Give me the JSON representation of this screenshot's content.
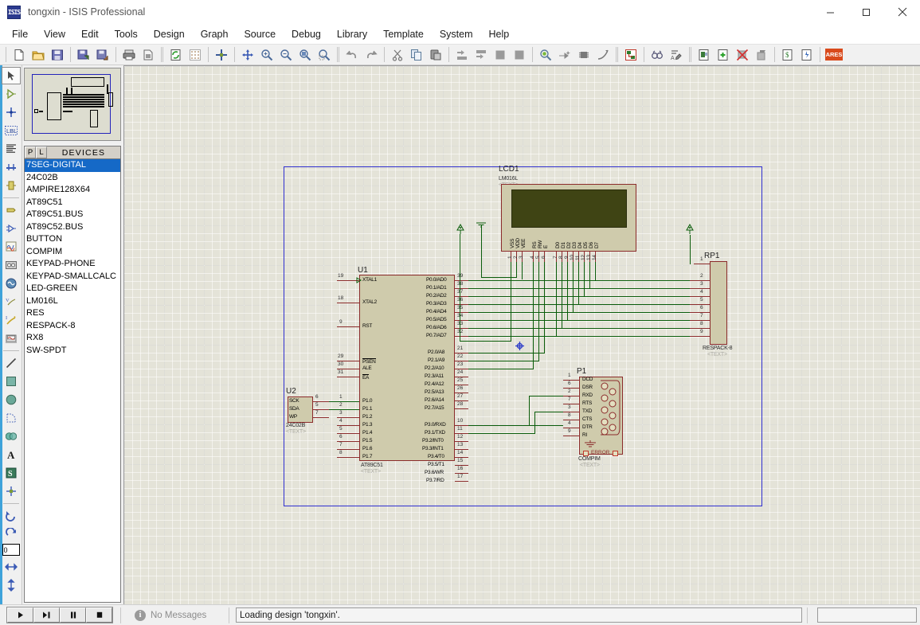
{
  "window": {
    "title": "tongxin - ISIS Professional",
    "app_icon": "isis-logo-icon",
    "minimize": "minimize-icon",
    "maximize": "maximize-icon",
    "close": "close-icon"
  },
  "menu": {
    "items": [
      {
        "label": "File"
      },
      {
        "label": "View"
      },
      {
        "label": "Edit"
      },
      {
        "label": "Tools"
      },
      {
        "label": "Design"
      },
      {
        "label": "Graph"
      },
      {
        "label": "Source"
      },
      {
        "label": "Debug"
      },
      {
        "label": "Library"
      },
      {
        "label": "Template"
      },
      {
        "label": "System"
      },
      {
        "label": "Help"
      }
    ]
  },
  "toolbar": {
    "groups": [
      [
        "new-file-icon",
        "open-folder-icon",
        "save-icon"
      ],
      [
        "import-section-icon",
        "export-section-icon"
      ],
      [
        "print-icon",
        "print-region-icon"
      ],
      [
        "refresh-display-icon",
        "toggle-grid-icon"
      ],
      [
        "origin-icon"
      ],
      [
        "pan-icon",
        "zoom-in-icon",
        "zoom-out-icon",
        "zoom-area-icon",
        "zoom-sheet-icon"
      ],
      [
        "undo-icon",
        "redo-icon"
      ],
      [
        "cut-icon",
        "copy-icon",
        "paste-icon"
      ],
      [
        "copy-block-icon",
        "move-block-icon",
        "rotate-block-icon",
        "delete-block-icon"
      ],
      [
        "pick-device-icon",
        "make-device-icon",
        "packaging-tool-icon",
        "decompose-icon"
      ],
      [
        "wire-label-icon"
      ],
      [
        "property-assignment-icon",
        "design-explorer-icon"
      ],
      [
        "new-sheet-icon",
        "remove-sheet-icon",
        "exit-sheet-icon",
        "bill-of-materials-icon"
      ],
      [
        "electrical-rules-check-icon",
        "netlist-icon"
      ],
      [
        "ares-pcb-icon"
      ]
    ],
    "ares_label": "ARES"
  },
  "vertical_toolbar": {
    "items": [
      {
        "name": "selection-mode-icon",
        "selected": true
      },
      {
        "name": "component-mode-icon",
        "selected": false
      },
      {
        "name": "junction-dot-mode-icon",
        "selected": false
      },
      {
        "name": "wire-label-mode-icon",
        "selected": false
      },
      {
        "name": "text-script-mode-icon",
        "selected": false
      },
      {
        "name": "buses-mode-icon",
        "selected": false
      },
      {
        "name": "subcircuit-mode-icon",
        "selected": false
      },
      {
        "name": "terminals-mode-icon",
        "selected": false
      },
      {
        "name": "device-pins-mode-icon",
        "selected": false
      },
      {
        "name": "graph-mode-icon",
        "selected": false
      },
      {
        "name": "tape-recorder-mode-icon",
        "selected": false
      },
      {
        "name": "generator-mode-icon",
        "selected": false
      },
      {
        "name": "voltage-probe-mode-icon",
        "selected": false
      },
      {
        "name": "current-probe-mode-icon",
        "selected": false
      },
      {
        "name": "virtual-instrument-mode-icon",
        "selected": false
      },
      {
        "name": "line-tool-icon",
        "selected": false
      },
      {
        "name": "box-tool-icon",
        "selected": false
      },
      {
        "name": "circle-tool-icon",
        "selected": false
      },
      {
        "name": "arc-tool-icon",
        "selected": false
      },
      {
        "name": "path-tool-icon",
        "selected": false
      },
      {
        "name": "text-tool-icon",
        "selected": false
      },
      {
        "name": "symbol-tool-icon",
        "selected": false
      },
      {
        "name": "marker-tool-icon",
        "selected": false
      },
      {
        "name": "rotate-clockwise-icon",
        "selected": false
      },
      {
        "name": "rotate-anticlockwise-icon",
        "selected": false
      },
      {
        "name": "rotation-value-field",
        "selected": false
      },
      {
        "name": "mirror-horizontal-icon",
        "selected": false
      },
      {
        "name": "mirror-vertical-icon",
        "selected": false
      }
    ],
    "rotation_value": "0"
  },
  "devices_panel": {
    "header_title": "DEVICES",
    "buttons": [
      {
        "label": "P",
        "name": "pick-from-libraries-button"
      },
      {
        "label": "L",
        "name": "library-manager-button"
      }
    ],
    "items": [
      {
        "label": "7SEG-DIGITAL",
        "selected": true
      },
      {
        "label": "24C02B",
        "selected": false
      },
      {
        "label": "AMPIRE128X64",
        "selected": false
      },
      {
        "label": "AT89C51",
        "selected": false
      },
      {
        "label": "AT89C51.BUS",
        "selected": false
      },
      {
        "label": "AT89C52.BUS",
        "selected": false
      },
      {
        "label": "BUTTON",
        "selected": false
      },
      {
        "label": "COMPIM",
        "selected": false
      },
      {
        "label": "KEYPAD-PHONE",
        "selected": false
      },
      {
        "label": "KEYPAD-SMALLCALC",
        "selected": false
      },
      {
        "label": "LED-GREEN",
        "selected": false
      },
      {
        "label": "LM016L",
        "selected": false
      },
      {
        "label": "RES",
        "selected": false
      },
      {
        "label": "RESPACK-8",
        "selected": false
      },
      {
        "label": "RX8",
        "selected": false
      },
      {
        "label": "SW-SPDT",
        "selected": false
      }
    ]
  },
  "schematic": {
    "components": [
      {
        "id": "U1",
        "reference": "U1",
        "value": "AT89C51",
        "text_label": "<TEXT>",
        "left_pins": [
          {
            "name": "XTAL1",
            "num": "19"
          },
          {
            "name": "XTAL2",
            "num": "18"
          },
          {
            "name": "RST",
            "num": "9"
          },
          {
            "name": "PSEN",
            "num": "29"
          },
          {
            "name": "ALE",
            "num": "30"
          },
          {
            "name": "EA",
            "num": "31"
          },
          {
            "name": "P1.0",
            "num": "1"
          },
          {
            "name": "P1.1",
            "num": "2"
          },
          {
            "name": "P1.2",
            "num": "3"
          },
          {
            "name": "P1.3",
            "num": "4"
          },
          {
            "name": "P1.4",
            "num": "5"
          },
          {
            "name": "P1.5",
            "num": "6"
          },
          {
            "name": "P1.6",
            "num": "7"
          },
          {
            "name": "P1.7",
            "num": "8"
          }
        ],
        "right_pins": [
          {
            "name": "P0.0/AD0",
            "num": "39"
          },
          {
            "name": "P0.1/AD1",
            "num": "38"
          },
          {
            "name": "P0.2/AD2",
            "num": "37"
          },
          {
            "name": "P0.3/AD3",
            "num": "36"
          },
          {
            "name": "P0.4/AD4",
            "num": "35"
          },
          {
            "name": "P0.5/AD5",
            "num": "34"
          },
          {
            "name": "P0.6/AD6",
            "num": "33"
          },
          {
            "name": "P0.7/AD7",
            "num": "32"
          },
          {
            "name": "P2.0/A8",
            "num": "21"
          },
          {
            "name": "P2.1/A9",
            "num": "22"
          },
          {
            "name": "P2.2/A10",
            "num": "23"
          },
          {
            "name": "P2.3/A11",
            "num": "24"
          },
          {
            "name": "P2.4/A12",
            "num": "25"
          },
          {
            "name": "P2.5/A13",
            "num": "26"
          },
          {
            "name": "P2.6/A14",
            "num": "27"
          },
          {
            "name": "P2.7/A15",
            "num": "28"
          },
          {
            "name": "P3.0/RXD",
            "num": "10"
          },
          {
            "name": "P3.1/TXD",
            "num": "11"
          },
          {
            "name": "P3.2/INT0",
            "num": "12"
          },
          {
            "name": "P3.3/INT1",
            "num": "13"
          },
          {
            "name": "P3.4/T0",
            "num": "14"
          },
          {
            "name": "P3.5/T1",
            "num": "15"
          },
          {
            "name": "P3.6/WR",
            "num": "16"
          },
          {
            "name": "P3.7/RD",
            "num": "17"
          }
        ]
      },
      {
        "id": "LCD1",
        "reference": "LCD1",
        "value": "LM016L",
        "text_label": "<TEXT>",
        "bottom_pins": [
          {
            "name": "VSS",
            "num": "1"
          },
          {
            "name": "VDD",
            "num": "2"
          },
          {
            "name": "VEE",
            "num": "3"
          },
          {
            "name": "RS",
            "num": "4"
          },
          {
            "name": "RW",
            "num": "5"
          },
          {
            "name": "E",
            "num": "6"
          },
          {
            "name": "D0",
            "num": "7"
          },
          {
            "name": "D1",
            "num": "8"
          },
          {
            "name": "D2",
            "num": "9"
          },
          {
            "name": "D3",
            "num": "10"
          },
          {
            "name": "D4",
            "num": "11"
          },
          {
            "name": "D5",
            "num": "12"
          },
          {
            "name": "D6",
            "num": "13"
          },
          {
            "name": "D7",
            "num": "14"
          }
        ]
      },
      {
        "id": "RP1",
        "reference": "RP1",
        "value": "RESPACK-8",
        "text_label": "<TEXT>",
        "left_pins": [
          {
            "num": "1"
          },
          {
            "num": "2"
          },
          {
            "num": "3"
          },
          {
            "num": "4"
          },
          {
            "num": "5"
          },
          {
            "num": "6"
          },
          {
            "num": "7"
          },
          {
            "num": "8"
          },
          {
            "num": "9"
          }
        ]
      },
      {
        "id": "P1",
        "reference": "P1",
        "value": "COMPIM",
        "text_label": "<TEXT>",
        "error_label": "ERROR",
        "pins": [
          {
            "name": "DCD",
            "num": "1"
          },
          {
            "name": "DSR",
            "num": "6"
          },
          {
            "name": "RXD",
            "num": "2"
          },
          {
            "name": "RTS",
            "num": "7"
          },
          {
            "name": "TXD",
            "num": "3"
          },
          {
            "name": "CTS",
            "num": "8"
          },
          {
            "name": "DTR",
            "num": "4"
          },
          {
            "name": "RI",
            "num": "9"
          }
        ]
      },
      {
        "id": "U2",
        "reference": "U2",
        "value": "24C02B",
        "text_label": "<TEXT>",
        "pins": [
          {
            "name": "SCK",
            "num": "6"
          },
          {
            "name": "SDA",
            "num": "5"
          },
          {
            "name": "WP",
            "num": "7"
          }
        ]
      }
    ]
  },
  "statusbar": {
    "animation_controls": [
      {
        "name": "play-button",
        "glyph": "play"
      },
      {
        "name": "step-button",
        "glyph": "step"
      },
      {
        "name": "pause-button",
        "glyph": "pause"
      },
      {
        "name": "stop-button",
        "glyph": "stop"
      }
    ],
    "messages_icon": "info-icon",
    "messages_label": "No Messages",
    "status_text": "Loading design 'tongxin'.",
    "coordinate_text": ""
  },
  "colors": {
    "accent": "#1569c7",
    "canvas": "#e4e3d8",
    "sheet_border": "#2f2fcf",
    "component_fill": "#cfcbac",
    "component_outline": "#8b2b2b",
    "wire": "#0a5c0a",
    "lcd_screen": "#3f4414",
    "ares": "#d94a1c"
  }
}
